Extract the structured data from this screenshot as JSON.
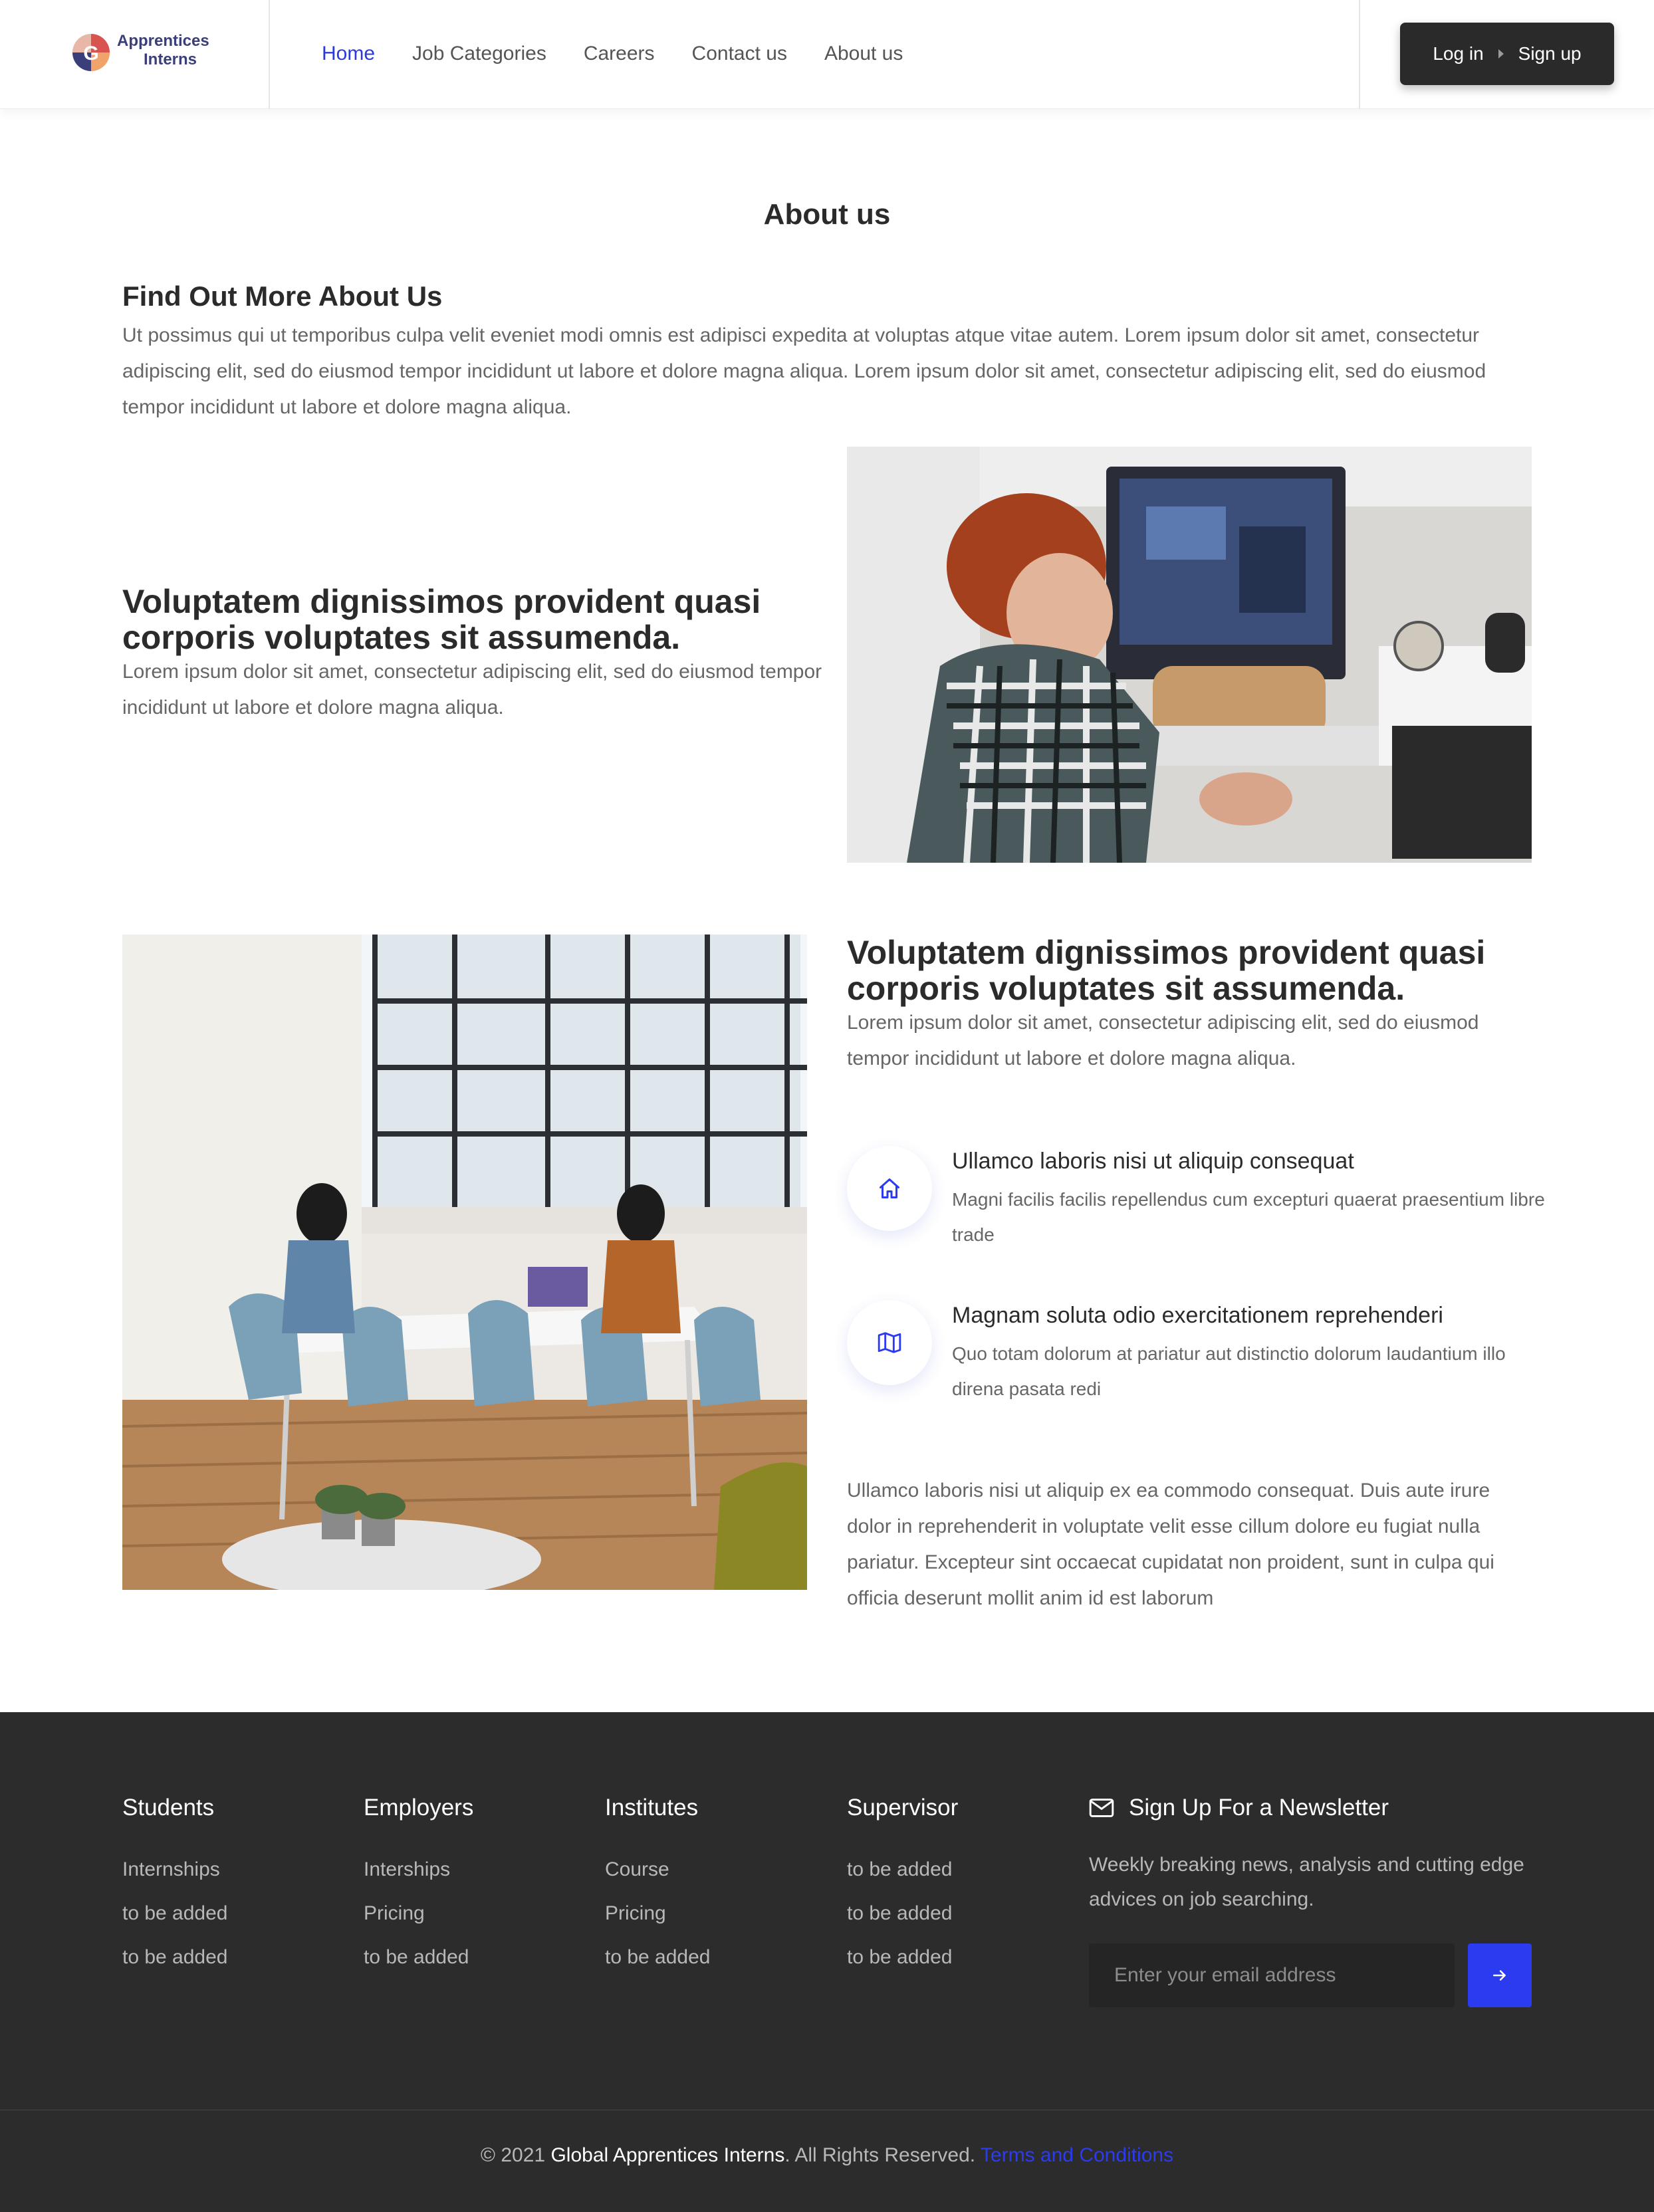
{
  "header": {
    "logo": {
      "line1": "Apprentices",
      "line2": "Interns",
      "mark_letter": "G"
    },
    "nav": [
      {
        "label": "Home",
        "active": true
      },
      {
        "label": "Job Categories",
        "active": false
      },
      {
        "label": "Careers",
        "active": false
      },
      {
        "label": "Contact us",
        "active": false
      },
      {
        "label": "About us",
        "active": false
      }
    ],
    "login_label": "Log in",
    "signup_label": "Sign up"
  },
  "main": {
    "page_title": "About us",
    "intro": {
      "title": "Find Out More About Us",
      "text": "Ut possimus qui ut temporibus culpa velit eveniet modi omnis est adipisci expedita at voluptas atque vitae autem. Lorem ipsum dolor sit amet, consectetur adipiscing elit, sed do eiusmod tempor incididunt ut labore et dolore magna aliqua. Lorem ipsum dolor sit amet, consectetur adipiscing elit, sed do eiusmod tempor incididunt ut labore et dolore magna aliqua."
    },
    "feature1": {
      "title": "Voluptatem dignissimos provident quasi corporis voluptates sit assumenda.",
      "text": "Lorem ipsum dolor sit amet, consectetur adipiscing elit, sed do eiusmod tempor incididunt ut labore et dolore magna aliqua."
    },
    "feature2": {
      "title": "Voluptatem dignissimos provident quasi corporis voluptates sit assumenda.",
      "text": "Lorem ipsum dolor sit amet, consectetur adipiscing elit, sed do eiusmod tempor incididunt ut labore et dolore magna aliqua.",
      "items": [
        {
          "icon": "home-icon",
          "title": "Ullamco laboris nisi ut aliquip consequat",
          "text": "Magni facilis facilis repellendus cum excepturi quaerat praesentium libre trade"
        },
        {
          "icon": "map-icon",
          "title": "Magnam soluta odio exercitationem reprehenderi",
          "text": "Quo totam dolorum at pariatur aut distinctio dolorum laudantium illo direna pasata redi"
        }
      ],
      "paragraph": "Ullamco laboris nisi ut aliquip ex ea commodo consequat. Duis aute irure dolor in reprehenderit in voluptate velit esse cillum dolore eu fugiat nulla pariatur. Excepteur sint occaecat cupidatat non proident, sunt in culpa qui officia deserunt mollit anim id est laborum"
    }
  },
  "footer": {
    "columns": [
      {
        "title": "Students",
        "links": [
          "Internships",
          "to be added",
          "to be added"
        ]
      },
      {
        "title": "Employers",
        "links": [
          "Interships",
          "Pricing",
          "to be added"
        ]
      },
      {
        "title": "Institutes",
        "links": [
          "Course",
          "Pricing",
          "to be added"
        ]
      },
      {
        "title": "Supervisor",
        "links": [
          "to be added",
          "to be added",
          "to be added"
        ]
      }
    ],
    "newsletter": {
      "title": "Sign Up For a Newsletter",
      "text": "Weekly breaking news, analysis and cutting edge advices on job searching.",
      "placeholder": "Enter your email address"
    },
    "copyright": {
      "prefix": "© 2021",
      "brand": "Global Apprentices Interns",
      "suffix": ". All Rights Reserved.",
      "terms": "Terms and Conditions"
    }
  },
  "colors": {
    "accent": "#2b3bf0",
    "nav_active": "#2b3bd9",
    "footer_bg": "#2c2c2c",
    "auth_bg": "#2a2a2a"
  }
}
